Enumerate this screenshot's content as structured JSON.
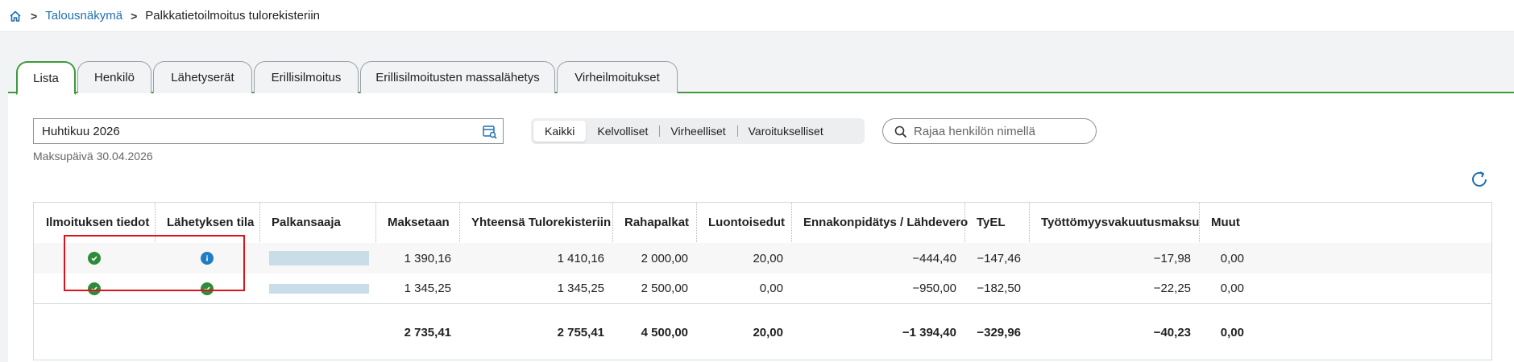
{
  "breadcrumb": {
    "home_icon": "home-icon",
    "items": [
      "Talousnäkymä",
      "Palkkatietoilmoitus tulorekisteriin"
    ],
    "separator": ">"
  },
  "tabs": [
    "Lista",
    "Henkilö",
    "Lähetyserät",
    "Erillisilmoitus",
    "Erillisilmoitusten massalähetys",
    "Virheilmoitukset"
  ],
  "active_tab": "Lista",
  "period": {
    "value": "Huhtikuu 2026",
    "icon": "calendar-search-icon"
  },
  "paydate": "Maksupäivä 30.04.2026",
  "filters": {
    "items": [
      "Kaikki",
      "Kelvolliset",
      "Virheelliset",
      "Varoitukselliset"
    ],
    "active": "Kaikki"
  },
  "search": {
    "placeholder": "Rajaa henkilön nimellä",
    "value": ""
  },
  "refresh_icon": "refresh-icon",
  "table": {
    "columns": [
      "Ilmoituksen tiedot",
      "Lähetyksen tila",
      "Palkansaaja",
      "Maksetaan",
      "Yhteensä Tulorekisteriin",
      "Rahapalkat",
      "Luontoisedut",
      "Ennakonpidätys / Lähdevero",
      "TyEL",
      "Työttömyysvakuutusmaksu",
      "Muut"
    ],
    "rows": [
      {
        "ilmoitus_status": "ok",
        "lahetys_status": "info",
        "palkansaaja": "",
        "cells": [
          "1 390,16",
          "1 410,16",
          "2 000,00",
          "20,00",
          "−444,40",
          "−147,46",
          "−17,98",
          "0,00"
        ]
      },
      {
        "ilmoitus_status": "ok",
        "lahetys_status": "ok",
        "palkansaaja": "",
        "cells": [
          "1 345,25",
          "1 345,25",
          "2 500,00",
          "0,00",
          "−950,00",
          "−182,50",
          "−22,25",
          "0,00"
        ]
      }
    ],
    "totals": [
      "2 735,41",
      "2 755,41",
      "4 500,00",
      "20,00",
      "−1 394,40",
      "−329,96",
      "−40,23",
      "0,00"
    ]
  },
  "colors": {
    "accent_green": "#3c9a3c",
    "link_blue": "#1f6fb2",
    "status_ok": "#2e8b3a",
    "status_info": "#1f7dc4",
    "highlight_red": "#d9151b"
  }
}
